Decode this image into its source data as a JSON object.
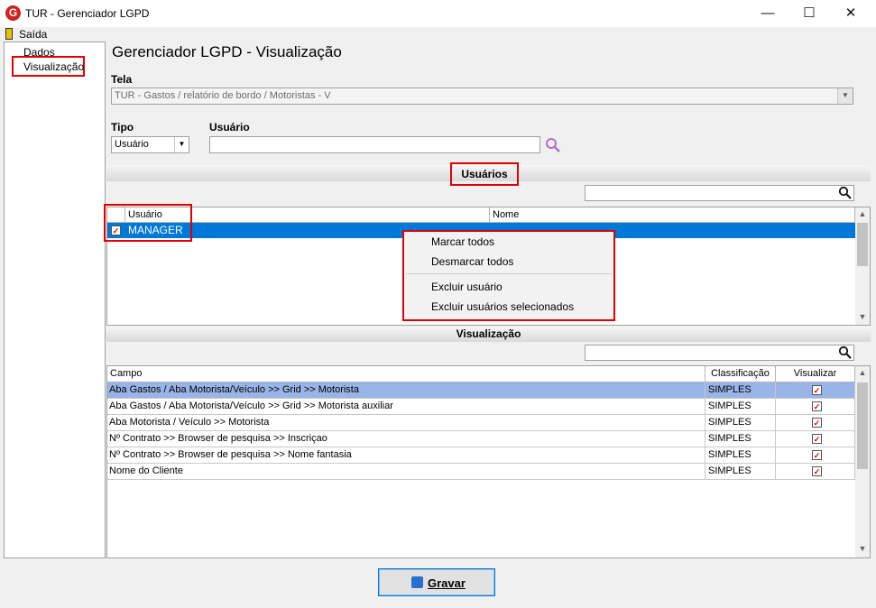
{
  "window": {
    "title": "TUR - Gerenciador LGPD",
    "icon_letter": "G",
    "minimize": "—",
    "maximize": "☐",
    "close": "✕"
  },
  "menu": {
    "exit_label": "Saída"
  },
  "tree": {
    "items": [
      "Dados",
      "Visualização"
    ]
  },
  "page_title": "Gerenciador LGPD - Visualização",
  "tela": {
    "label": "Tela",
    "value": "TUR - Gastos / relatório de bordo / Motoristas - V"
  },
  "tipo": {
    "label": "Tipo",
    "value": "Usuário",
    "arrow": "▼"
  },
  "usuario": {
    "label": "Usuário",
    "value": ""
  },
  "usuarios_section": {
    "title": "Usuários",
    "search_value": "",
    "columns": [
      "Usuário",
      "Nome"
    ],
    "rows": [
      {
        "checked": true,
        "usuario": "MANAGER",
        "nome": ""
      }
    ]
  },
  "context_menu": {
    "items": [
      "Marcar todos",
      "Desmarcar todos",
      "Excluir usuário",
      "Excluir usuários selecionados"
    ]
  },
  "visualizacao_section": {
    "title": "Visualização",
    "search_value": "",
    "columns": [
      "Campo",
      "Classificação",
      "Visualizar"
    ],
    "rows": [
      {
        "campo": "Aba Gastos / Aba  Motorista/Veículo >> Grid >> Motorista",
        "classificacao": "SIMPLES",
        "visualizar": true
      },
      {
        "campo": "Aba Gastos / Aba  Motorista/Veículo >> Grid >> Motorista auxiliar",
        "classificacao": "SIMPLES",
        "visualizar": true
      },
      {
        "campo": "Aba Motorista / Veículo >> Motorista",
        "classificacao": "SIMPLES",
        "visualizar": true
      },
      {
        "campo": "Nº Contrato >> Browser de pesquisa >> Inscriçao",
        "classificacao": "SIMPLES",
        "visualizar": true
      },
      {
        "campo": "Nº Contrato >> Browser de pesquisa >> Nome fantasia",
        "classificacao": "SIMPLES",
        "visualizar": true
      },
      {
        "campo": "Nome do Cliente",
        "classificacao": "SIMPLES",
        "visualizar": true
      }
    ]
  },
  "save_button": {
    "label": "Gravar"
  },
  "colors": {
    "selection_blue": "#0078d7",
    "row_highlight": "#99b4e6",
    "highlight_red": "#e00000"
  }
}
